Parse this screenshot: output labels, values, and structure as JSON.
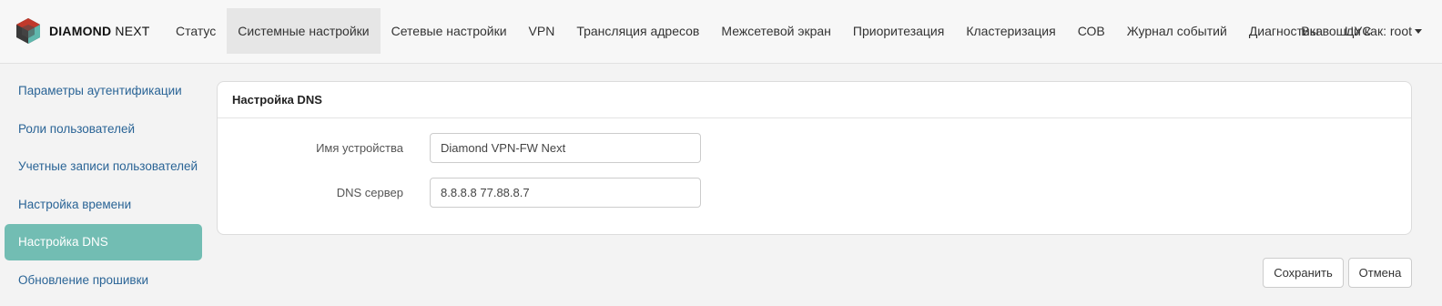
{
  "brand": {
    "name_bold": "DIAMOND",
    "name_rest": "NEXT",
    "logo_icon": "diamond-cube-logo"
  },
  "nav": {
    "items": [
      {
        "label": "Статус",
        "active": false
      },
      {
        "label": "Системные настройки",
        "active": true
      },
      {
        "label": "Сетевые настройки",
        "active": false
      },
      {
        "label": "VPN",
        "active": false
      },
      {
        "label": "Трансляция адресов",
        "active": false
      },
      {
        "label": "Межсетевой экран",
        "active": false
      },
      {
        "label": "Приоритезация",
        "active": false
      },
      {
        "label": "Кластеризация",
        "active": false
      },
      {
        "label": "СОВ",
        "active": false
      },
      {
        "label": "Журнал событий",
        "active": false
      },
      {
        "label": "Диагностика",
        "active": false
      },
      {
        "label": "ЦУС",
        "active": false
      }
    ],
    "user_label": "Вы вошли как: root"
  },
  "sidebar": {
    "items": [
      {
        "label": "Параметры аутентификации",
        "active": false
      },
      {
        "label": "Роли пользователей",
        "active": false
      },
      {
        "label": "Учетные записи пользователей",
        "active": false
      },
      {
        "label": "Настройка времени",
        "active": false
      },
      {
        "label": "Настройка DNS",
        "active": true
      },
      {
        "label": "Обновление прошивки",
        "active": false
      }
    ]
  },
  "panel": {
    "title": "Настройка DNS",
    "fields": {
      "device_name": {
        "label": "Имя устройства",
        "value": "Diamond VPN-FW Next"
      },
      "dns_server": {
        "label": "DNS сервер",
        "value": "8.8.8.8 77.88.8.7"
      }
    }
  },
  "actions": {
    "save_label": "Сохранить",
    "cancel_label": "Отмена"
  },
  "colors": {
    "accent": "#72bdb3",
    "link": "#2a6496",
    "logo_dark": "#3a3a3a",
    "logo_red": "#c0392b",
    "logo_teal": "#5fb7ad"
  }
}
